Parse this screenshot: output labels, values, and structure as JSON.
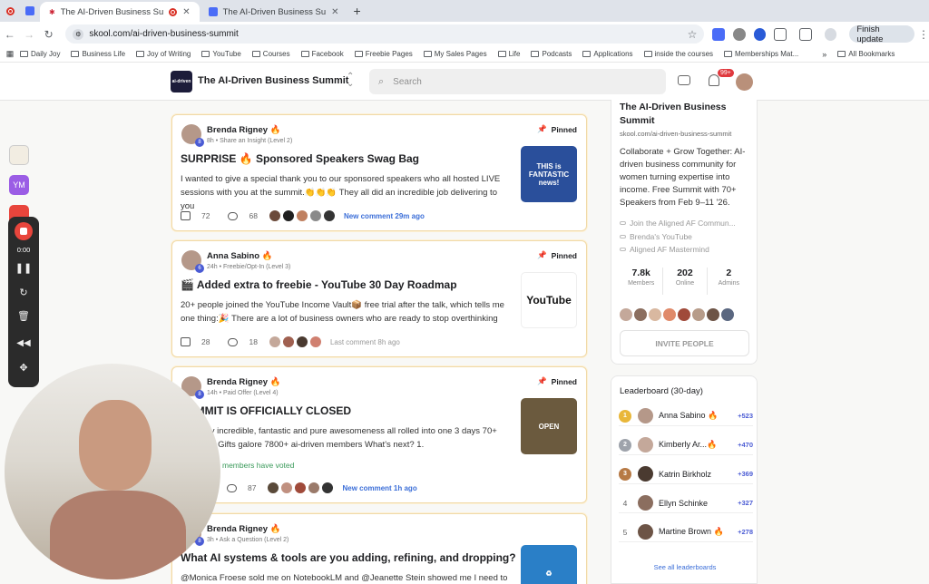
{
  "browser": {
    "tabs": [
      {
        "title": "The AI-Driven Business Su",
        "active": true
      },
      {
        "title": "The AI-Driven Business Su",
        "active": false
      }
    ],
    "new_tab": "+",
    "url": "skool.com/ai-driven-business-summit",
    "finish_update": "Finish update",
    "bookmarks": [
      "Daily Joy",
      "Business Life",
      "Joy of Writing",
      "YouTube",
      "Courses",
      "Facebook",
      "Freebie Pages",
      "My Sales Pages",
      "Life",
      "Podcasts",
      "Applications",
      "inside the courses",
      "Memberships Mat..."
    ],
    "bookmarks_more": "»",
    "all_bookmarks": "All Bookmarks"
  },
  "header": {
    "logo_text": "ai-driven",
    "group_title": "The AI-Driven Business Summit",
    "search_placeholder": "Search",
    "notif_badge": "99+"
  },
  "posts": [
    {
      "author": "Brenda Rigney",
      "level_badge": "8",
      "meta": "8h • Share an Insight (Level 2)",
      "pinned_label": "Pinned",
      "title": "SURPRISE 🔥 Sponsored Speakers Swag Bag",
      "body": "I wanted to give a special thank you to our sponsored speakers who all hosted LIVE sessions with you at the summit.👏👏👏 They all did an incredible job delivering to you",
      "likes": "72",
      "comments": "68",
      "activity": "New comment 29m ago",
      "activity_new": true,
      "thumb_caption": "THIS is FANTASTIC news!",
      "thumb_color": "#2a4f9b"
    },
    {
      "author": "Anna Sabino",
      "level_badge": "6",
      "meta": "24h • Freebie/Opt-In (Level 3)",
      "pinned_label": "Pinned",
      "title": "🎬 Added extra to freebie - YouTube 30 Day Roadmap",
      "body": "20+ people joined the YouTube Income Vault📦 free trial after the talk, which tells me one thing:🎉 There are a lot of business owners who are ready to stop overthinking",
      "likes": "28",
      "comments": "18",
      "activity": "Last comment 8h ago",
      "activity_new": false,
      "thumb_caption": "YouTube",
      "thumb_color": "#ffffff"
    },
    {
      "author": "Brenda Rigney",
      "level_badge": "8",
      "meta": "14h • Paid Offer (Level 4)",
      "pinned_label": "Pinned",
      "title": "SUMMIT IS OFFICIALLY CLOSED",
      "body": "was truly incredible, fantastic and pure awesomeness all rolled into one 3 days 70+ speakers Gifts galore 7800+ ai-driven members What's next? 1.",
      "poll_text": "members have voted",
      "likes": "",
      "comments": "87",
      "activity": "New comment 1h ago",
      "activity_new": true,
      "thumb_caption": "OPEN",
      "thumb_color": "#6b5a3e"
    },
    {
      "author": "Brenda Rigney",
      "level_badge": "8",
      "meta": "3h • Ask a Question (Level 2)",
      "title": "What AI systems & tools are you adding, refining, and dropping?",
      "body": "@Monica Froese sold me on NotebookLM and @Jeanette Stein showed me I need to",
      "thumb_caption": "♻",
      "thumb_color": "#2a7fc7"
    }
  ],
  "sidebar": {
    "title": "The AI-Driven Business Summit",
    "url": "skool.com/ai-driven-business-summit",
    "description": "Collaborate + Grow Together: AI-driven business community for women turning expertise into income. Free Summit with 70+ Speakers from Feb 9–11 '26.",
    "links": [
      "Join the Aligned AF Commun...",
      "Brenda's YouTube",
      "Aligned AF Mastermind"
    ],
    "stats": [
      {
        "value": "7.8k",
        "label": "Members"
      },
      {
        "value": "202",
        "label": "Online"
      },
      {
        "value": "2",
        "label": "Admins"
      }
    ],
    "invite_label": "INVITE PEOPLE"
  },
  "leaderboard": {
    "title": "Leaderboard (30-day)",
    "rows": [
      {
        "rank": "1",
        "name": "Anna Sabino 🔥",
        "points": "+523",
        "medal": "#e9b73a"
      },
      {
        "rank": "2",
        "name": "Kimberly Ar...🔥",
        "points": "+470",
        "medal": "#9ea3ab"
      },
      {
        "rank": "3",
        "name": "Katrin Birkholz",
        "points": "+369",
        "medal": "#b77a45"
      },
      {
        "rank": "4",
        "name": "Ellyn Schinke",
        "points": "+327",
        "medal": ""
      },
      {
        "rank": "5",
        "name": "Martine Brown 🔥",
        "points": "+278",
        "medal": ""
      }
    ],
    "see_all": "See all leaderboards"
  },
  "recorder": {
    "ext_initials": "YM",
    "timer": "0:00"
  },
  "colors": {
    "accent_blue": "#4a5bd4",
    "link_blue": "#3b6ed8",
    "pinned_border": "#f0d9a8",
    "badge_red": "#e0393e",
    "record_red": "#e8453c"
  }
}
